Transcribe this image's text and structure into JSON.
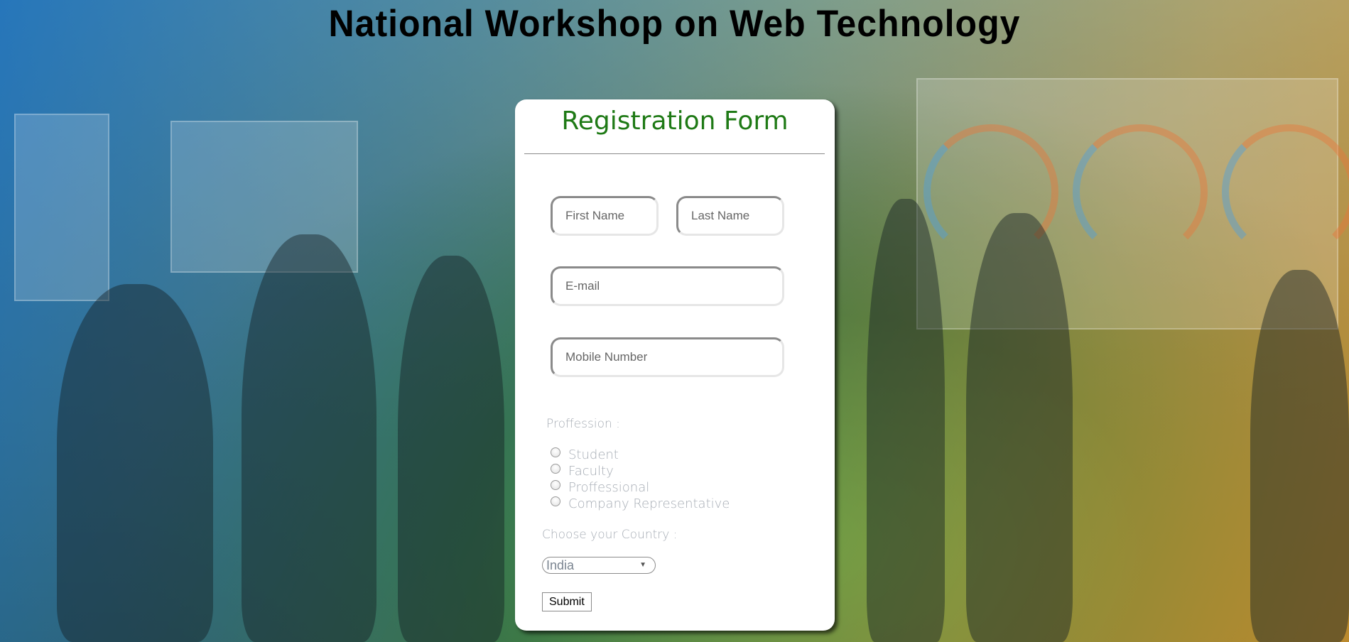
{
  "page": {
    "title": "National Workshop on Web Technology"
  },
  "form": {
    "title": "Registration Form",
    "first_name_placeholder": "First Name",
    "last_name_placeholder": "Last Name",
    "email_placeholder": "E-mail",
    "mobile_placeholder": "Mobile Number",
    "profession_label": "Proffession :",
    "profession_options": [
      {
        "label": "Student",
        "checked": false
      },
      {
        "label": "Faculty",
        "checked": false
      },
      {
        "label": "Proffessional",
        "checked": false
      },
      {
        "label": "Company Representative",
        "checked": false
      }
    ],
    "country_label": "Choose your Country :",
    "country_selected": "India",
    "submit_label": "Submit"
  },
  "colors": {
    "form_title": "#1f7a16",
    "muted_text": "#a7adb5"
  }
}
